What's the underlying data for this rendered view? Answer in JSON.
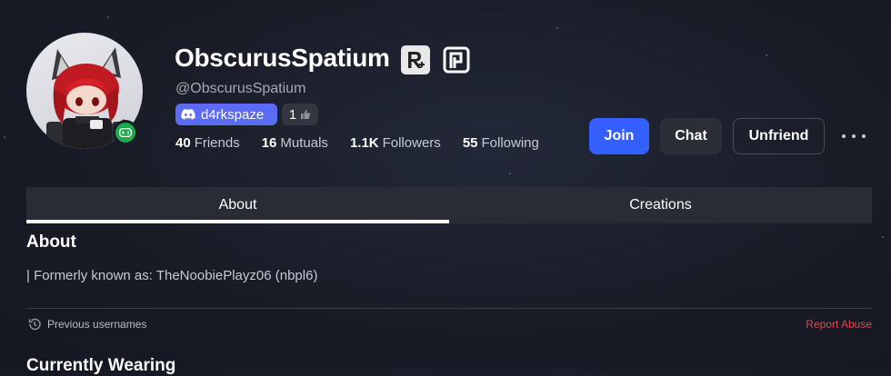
{
  "profile": {
    "display_name": "ObscurusSpatium",
    "username": "@ObscurusSpatium",
    "discord_handle": "d4rkspaze",
    "rating_count": "1",
    "presence_color": "#1fa84a",
    "badges": [
      "r-plus-badge-icon",
      "p-badge-icon"
    ]
  },
  "stats": [
    {
      "value": "40",
      "label": "Friends"
    },
    {
      "value": "16",
      "label": "Mutuals"
    },
    {
      "value": "1.1K",
      "label": "Followers"
    },
    {
      "value": "55",
      "label": "Following"
    }
  ],
  "actions": {
    "join": "Join",
    "chat": "Chat",
    "unfriend": "Unfriend"
  },
  "tabs": [
    {
      "label": "About",
      "active": true
    },
    {
      "label": "Creations",
      "active": false
    }
  ],
  "about": {
    "title": "About",
    "text": "| Formerly known as: TheNoobiePlayz06 (nbpl6)",
    "previous_usernames": "Previous usernames",
    "report_abuse": "Report Abuse"
  },
  "wearing": {
    "title": "Currently Wearing"
  },
  "colors": {
    "accent": "#335fff",
    "discord": "#5c6bf3",
    "report": "#e0484d"
  }
}
